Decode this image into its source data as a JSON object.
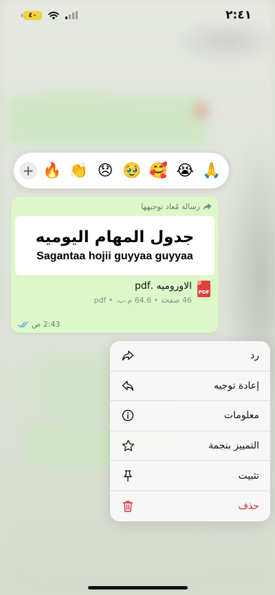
{
  "status_bar": {
    "time": "٢:٤١",
    "battery": "٤٠"
  },
  "reactions": {
    "add_label": "+",
    "emojis": [
      "🔥",
      "👏",
      "😞",
      "🥹",
      "🥰",
      "😭",
      "🙏"
    ]
  },
  "message": {
    "forwarded_label": "رسالة مُعاد توجيهها",
    "preview_title_ar": "جدول المهام اليوميه",
    "preview_title_en": "Sagantaa hojii guyyaa guyyaa",
    "file_name": "الاوروميه .pdf",
    "file_meta": "46 صفحة • 64.6 م.ب. • pdf",
    "file_type_badge": "PDF",
    "time": "2:43 ص"
  },
  "context_menu": {
    "items": [
      {
        "label": "رد",
        "icon": "reply-icon"
      },
      {
        "label": "إعادة توجيه",
        "icon": "forward-icon"
      },
      {
        "label": "معلومات",
        "icon": "info-icon"
      },
      {
        "label": "التمييز بنجمة",
        "icon": "star-icon"
      },
      {
        "label": "تثبيت",
        "icon": "pin-icon"
      },
      {
        "label": "حذف",
        "icon": "trash-icon"
      }
    ]
  },
  "colors": {
    "bubble": "#dcf7c8",
    "danger": "#d62a3b",
    "read_ticks": "#4fa3f0"
  }
}
